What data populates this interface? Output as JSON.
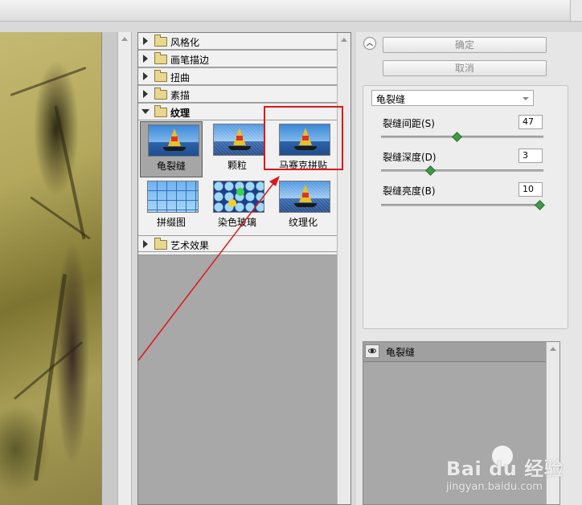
{
  "filter_categories": [
    {
      "label": "风格化",
      "expanded": false
    },
    {
      "label": "画笔描边",
      "expanded": false
    },
    {
      "label": "扭曲",
      "expanded": false
    },
    {
      "label": "素描",
      "expanded": false
    },
    {
      "label": "纹理",
      "expanded": true
    },
    {
      "label": "艺术效果",
      "expanded": false
    }
  ],
  "texture_filters": [
    {
      "label": "龟裂缝",
      "selected": true
    },
    {
      "label": "颗粒",
      "selected": false
    },
    {
      "label": "马赛克拼贴",
      "selected": false,
      "highlighted": true
    },
    {
      "label": "拼缀图",
      "selected": false
    },
    {
      "label": "染色玻璃",
      "selected": false
    },
    {
      "label": "纹理化",
      "selected": false
    }
  ],
  "buttons": {
    "ok": "确定",
    "cancel": "取消"
  },
  "settings": {
    "filter_select": "龟裂缝",
    "params": [
      {
        "label": "裂缝间距(S)",
        "value": "47",
        "level": 0.47
      },
      {
        "label": "裂缝深度(D)",
        "value": "3",
        "level": 0.3
      },
      {
        "label": "裂缝亮度(B)",
        "value": "10",
        "level": 1.0
      }
    ]
  },
  "layers": [
    {
      "name": "龟裂缝",
      "visible": true
    }
  ],
  "watermark": {
    "brand": "Bai du 经验",
    "url": "jingyan.baidu.com"
  },
  "colors": {
    "highlight": "#e01616",
    "slider_knob": "#3d9b46"
  }
}
